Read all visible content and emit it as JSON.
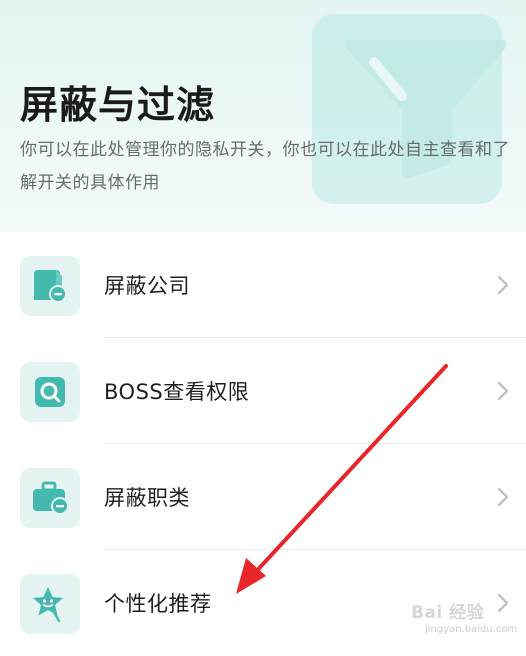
{
  "header": {
    "title": "屏蔽与过滤",
    "subtitle": "你可以在此处管理你的隐私开关，你也可以在此处自主查看和了解开关的具体作用",
    "decor_icon": "funnel-icon"
  },
  "settings": {
    "items": [
      {
        "label": "屏蔽公司",
        "icon": "company-block-icon"
      },
      {
        "label": "BOSS查看权限",
        "icon": "search-icon"
      },
      {
        "label": "屏蔽职类",
        "icon": "briefcase-block-icon"
      },
      {
        "label": "个性化推荐",
        "icon": "star-recommend-icon"
      }
    ]
  },
  "watermark": {
    "brand": "Bai 经验",
    "sub": "jingyan.baidu.com"
  },
  "colors": {
    "accent": "#44b9ae",
    "accent_light": "#e5f4f2",
    "annotation_arrow": "#e8262a"
  }
}
